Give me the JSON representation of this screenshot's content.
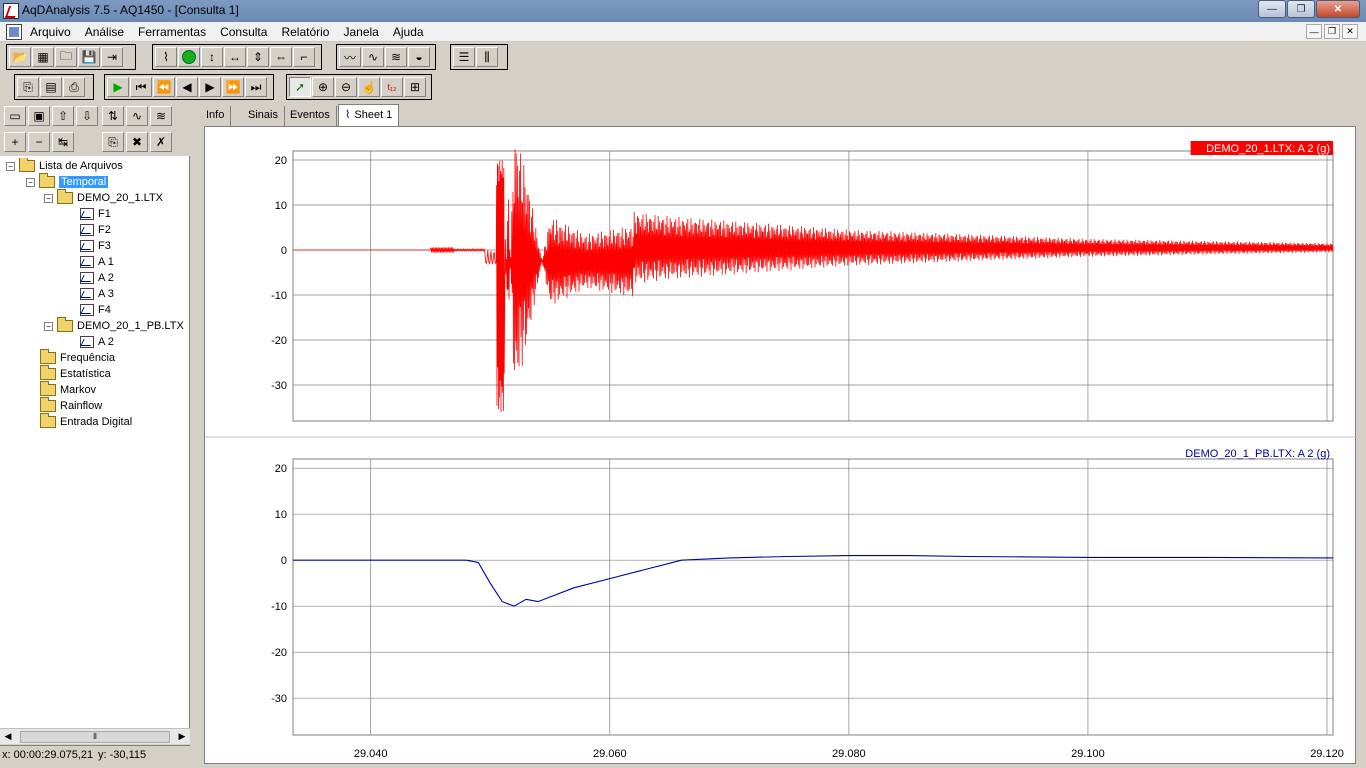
{
  "window": {
    "title": "AqDAnalysis 7.5 - AQ1450 - [Consulta 1]",
    "minimize": "—",
    "maximize": "❐",
    "close": "✕"
  },
  "menu": {
    "items": [
      "Arquivo",
      "Análise",
      "Ferramentas",
      "Consulta",
      "Relatório",
      "Janela",
      "Ajuda"
    ],
    "mdi_minimize": "—",
    "mdi_restore": "❐",
    "mdi_close": "✕"
  },
  "tree": {
    "root": "Lista de Arquivos",
    "temporal": "Temporal",
    "file1": "DEMO_20_1.LTX",
    "file1_signals": [
      "F1",
      "F2",
      "F3",
      "A 1",
      "A 2",
      "A 3",
      "F4"
    ],
    "file2": "DEMO_20_1_PB.LTX",
    "file2_signals": [
      "A 2"
    ],
    "folders": [
      "Frequência",
      "Estatística",
      "Markov",
      "Rainflow",
      "Entrada Digital"
    ]
  },
  "tabs": [
    "Info",
    "Sinais",
    "Eventos",
    "Sheet 1"
  ],
  "status": {
    "x": "x: 00:00:29.075,21",
    "y": "y: -30,115"
  },
  "colors": {
    "series1": "#ff0000",
    "series2": "#0000a8",
    "grid": "#808080"
  },
  "chart_data": [
    {
      "type": "line",
      "title": "DEMO_20_1.LTX: A 2 (g)",
      "ylim": [
        -38,
        22
      ],
      "yticks": [
        20,
        10,
        0,
        -10,
        -20,
        -30
      ],
      "xlim": [
        29.0335,
        29.1205
      ],
      "xticks": [
        "29.040",
        "29.060",
        "29.080",
        "29.100",
        "29.120"
      ],
      "grid": true,
      "legend_position": "top-right",
      "series": [
        {
          "name": "DEMO_20_1.LTX: A 2 (g)",
          "color": "#ff0000",
          "x": [
            29.0335,
            29.045,
            29.046,
            29.0495,
            29.05,
            29.0505,
            29.051,
            29.0515,
            29.052,
            29.053,
            29.055,
            29.058,
            29.062,
            29.065,
            29.07,
            29.08,
            29.09,
            29.1,
            29.11,
            29.1205
          ],
          "y": [
            0,
            0,
            1,
            0,
            -2,
            20,
            -36,
            18,
            -30,
            -20,
            10,
            6,
            8,
            7,
            6,
            4,
            3,
            2,
            1.5,
            1
          ]
        }
      ]
    },
    {
      "type": "line",
      "title": "DEMO_20_1_PB.LTX: A 2 (g)",
      "ylim": [
        -38,
        22
      ],
      "yticks": [
        20,
        10,
        0,
        -10,
        -20,
        -30
      ],
      "xlim": [
        29.0335,
        29.1205
      ],
      "xticks": [
        "29.040",
        "29.060",
        "29.080",
        "29.100",
        "29.120"
      ],
      "grid": true,
      "legend_position": "top-right",
      "series": [
        {
          "name": "DEMO_20_1_PB.LTX: A 2 (g)",
          "x": [
            29.0335,
            29.04,
            29.045,
            29.048,
            29.049,
            29.05,
            29.051,
            29.052,
            29.053,
            29.054,
            29.055,
            29.057,
            29.06,
            29.063,
            29.066,
            29.07,
            29.075,
            29.08,
            29.085,
            29.09,
            29.1,
            29.11,
            29.1205
          ],
          "y": [
            0,
            0,
            0,
            0,
            -0.5,
            -5,
            -9,
            -10,
            -8.5,
            -9,
            -8,
            -6,
            -4,
            -2,
            0,
            0.5,
            0.8,
            1,
            1,
            0.8,
            0.6,
            0.6,
            0.5
          ],
          "color": "#0000a8"
        }
      ]
    }
  ]
}
